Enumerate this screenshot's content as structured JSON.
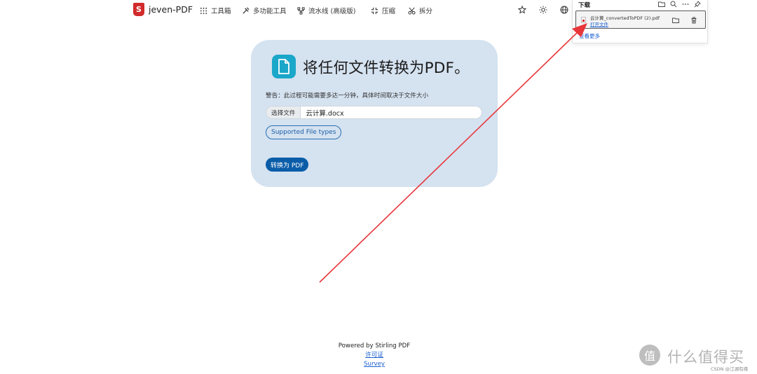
{
  "navbar": {
    "brand": "jeven-PDF",
    "items": [
      {
        "label": "工具箱",
        "icon": "grid-icon"
      },
      {
        "label": "多功能工具",
        "icon": "tools-icon"
      },
      {
        "label": "流水线 (高级版)",
        "icon": "pipeline-icon"
      },
      {
        "label": "压缩",
        "icon": "compress-icon"
      },
      {
        "label": "拆分",
        "icon": "scissors-icon"
      }
    ],
    "right_icons": [
      "star-icon",
      "sun-icon",
      "globe-icon"
    ]
  },
  "card": {
    "title": "将任何文件转换为PDF。",
    "warning": "警告：此过程可能需要多达一分钟，具体时间取决于文件大小",
    "file_button": "选择文件",
    "file_name": "云计算.docx",
    "supported_button": "Supported File types",
    "convert_button": "转换为 PDF"
  },
  "footer": {
    "powered": "Powered by Stirling PDF",
    "license": "许可证",
    "survey": "Survey"
  },
  "downloads": {
    "title": "下载",
    "file_name": "云计算_convertedToPDF (2).pdf",
    "open_file": "打开文件",
    "see_more": "查看更多"
  },
  "watermark": {
    "logo_char": "值",
    "text": "什么值得买",
    "small": "CSDN @江湖有缘"
  },
  "colors": {
    "card_bg": "#d5e2f0",
    "accent": "#0a5da8",
    "doc_badge": "#1ba7c9",
    "arrow": "#e8363a"
  }
}
